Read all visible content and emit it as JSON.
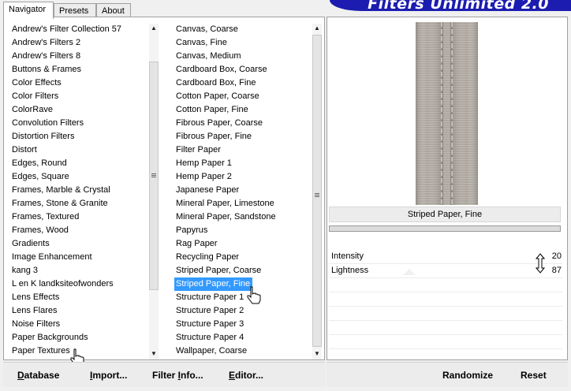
{
  "header": {
    "tabs": [
      {
        "label": "Navigator",
        "active": true
      },
      {
        "label": "Presets",
        "active": false
      },
      {
        "label": "About",
        "active": false
      }
    ],
    "banner_title": "Filters Unlimited 2.0"
  },
  "categories": [
    "Andrew's Filter Collection 57",
    "Andrew's Filters 2",
    "Andrew's Filters 8",
    "Buttons & Frames",
    "Color Effects",
    "Color Filters",
    "ColorRave",
    "Convolution Filters",
    "Distortion Filters",
    "Distort",
    "Edges, Round",
    "Edges, Square",
    "Frames, Marble & Crystal",
    "Frames, Stone & Granite",
    "Frames, Textured",
    "Frames, Wood",
    "Gradients",
    "Image Enhancement",
    "kang 3",
    "L en K landksiteofwonders",
    "Lens Effects",
    "Lens Flares",
    "Noise Filters",
    "Paper Backgrounds",
    "Paper Textures"
  ],
  "filters": [
    "Canvas, Coarse",
    "Canvas, Fine",
    "Canvas, Medium",
    "Cardboard Box, Coarse",
    "Cardboard Box, Fine",
    "Cotton Paper, Coarse",
    "Cotton Paper, Fine",
    "Fibrous Paper, Coarse",
    "Fibrous Paper, Fine",
    "Filter Paper",
    "Hemp Paper 1",
    "Hemp Paper 2",
    "Japanese Paper",
    "Mineral Paper, Limestone",
    "Mineral Paper, Sandstone",
    "Papyrus",
    "Rag Paper",
    "Recycling Paper",
    "Striped Paper, Coarse",
    "Striped Paper, Fine",
    "Structure Paper 1",
    "Structure Paper 2",
    "Structure Paper 3",
    "Structure Paper 4",
    "Wallpaper, Coarse"
  ],
  "selected_filter": "Striped Paper, Fine",
  "preview": {
    "caption": "Striped Paper, Fine"
  },
  "sliders": [
    {
      "label": "Intensity",
      "value": "20"
    },
    {
      "label": "Lightness",
      "value": "87"
    }
  ],
  "buttons": {
    "database": {
      "first": "D",
      "rest": "atabase"
    },
    "import": {
      "first": "I",
      "rest": "mport..."
    },
    "filter_info": {
      "first": "Filter ",
      "under": "I",
      "rest": "nfo..."
    },
    "editor": {
      "first": "E",
      "rest": "ditor..."
    },
    "randomize": "Randomize",
    "reset": "Reset"
  },
  "colors": {
    "selection": "#3399ff",
    "banner": "#1c1cb0"
  }
}
